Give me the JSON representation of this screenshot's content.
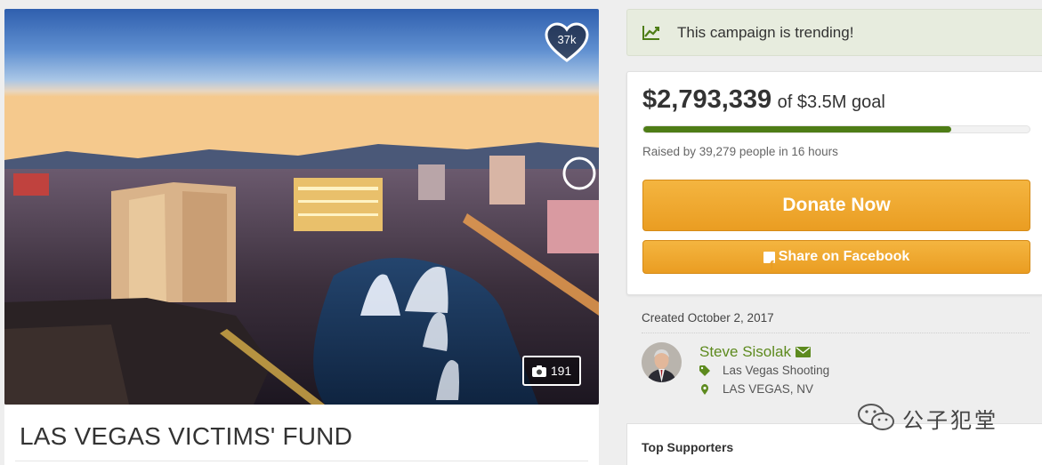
{
  "campaign": {
    "title": "LAS VEGAS VICTIMS' FUND",
    "likes": "37k",
    "photos": "191"
  },
  "trending": {
    "text": "This campaign is trending!",
    "icon": "trend-chart-icon"
  },
  "funding": {
    "raised": "$2,793,339",
    "goal_text": "of $3.5M goal",
    "progress_fraction": 0.798,
    "summary": "Raised by 39,279 people in 16 hours",
    "donate_label": "Donate Now",
    "share_label": "Share on Facebook"
  },
  "details": {
    "created": "Created October 2, 2017",
    "organizer": "Steve Sisolak",
    "category": "Las Vegas Shooting",
    "location": "LAS VEGAS, NV"
  },
  "supporters": {
    "heading": "Top Supporters"
  },
  "watermark": {
    "text": "公子犯堂"
  },
  "colors": {
    "accent_green": "#5d8a1e",
    "progress_green": "#4e7d16",
    "button_orange": "#f0a530",
    "trend_bg": "#e7ecde"
  }
}
